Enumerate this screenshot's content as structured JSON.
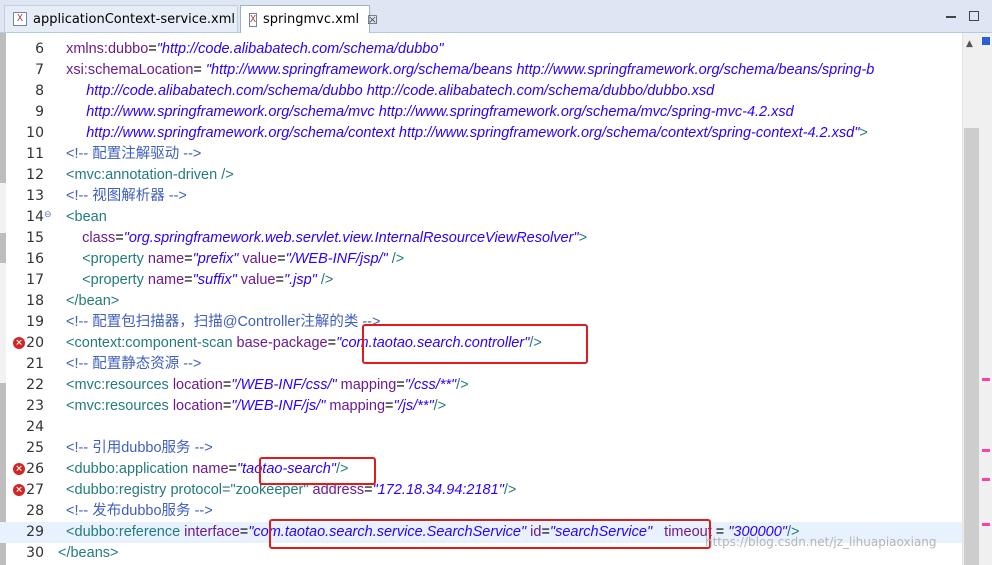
{
  "tabs": [
    {
      "label": "applicationContext-service.xml",
      "active": false
    },
    {
      "label": "springmvc.xml",
      "active": true,
      "close": "☒"
    }
  ],
  "lines": [
    {
      "n": "6",
      "tokens": [
        [
          "p",
          "  "
        ],
        [
          "a",
          "xmlns:dubbo"
        ],
        [
          "e",
          "="
        ],
        [
          "v",
          "\"http://code.alibabatech.com/schema/dubbo\""
        ]
      ]
    },
    {
      "n": "7",
      "tokens": [
        [
          "p",
          "  "
        ],
        [
          "a",
          "xsi:schemaLocation"
        ],
        [
          "e",
          "="
        ],
        [
          "v",
          " \"http://www.springframework.org/schema/beans http://www.springframework.org/schema/beans/spring-b"
        ]
      ]
    },
    {
      "n": "8",
      "tokens": [
        [
          "v",
          "       http://code.alibabatech.com/schema/dubbo http://code.alibabatech.com/schema/dubbo/dubbo.xsd"
        ]
      ]
    },
    {
      "n": "9",
      "tokens": [
        [
          "v",
          "       http://www.springframework.org/schema/mvc http://www.springframework.org/schema/mvc/spring-mvc-4.2.xsd"
        ]
      ]
    },
    {
      "n": "10",
      "tokens": [
        [
          "v",
          "       http://www.springframework.org/schema/context http://www.springframework.org/schema/context/spring-context-4.2.xsd\""
        ],
        [
          "t",
          ">"
        ]
      ]
    },
    {
      "n": "11",
      "tokens": [
        [
          "c",
          "  <!-- 配置注解驱动 -->"
        ]
      ]
    },
    {
      "n": "12",
      "tokens": [
        [
          "t",
          "  <mvc:annotation-driven />"
        ]
      ]
    },
    {
      "n": "13",
      "tokens": [
        [
          "c",
          "  <!-- 视图解析器 -->"
        ]
      ]
    },
    {
      "n": "14",
      "fold": true,
      "tokens": [
        [
          "t",
          "  <bean"
        ]
      ]
    },
    {
      "n": "15",
      "tokens": [
        [
          "a",
          "      class"
        ],
        [
          "e",
          "="
        ],
        [
          "v",
          "\"org.springframework.web.servlet.view.InternalResourceViewResolver\""
        ],
        [
          "t",
          ">"
        ]
      ]
    },
    {
      "n": "16",
      "tokens": [
        [
          "t",
          "      <property "
        ],
        [
          "a",
          "name"
        ],
        [
          "e",
          "="
        ],
        [
          "v",
          "\"prefix\""
        ],
        [
          "a",
          " value"
        ],
        [
          "e",
          "="
        ],
        [
          "v",
          "\"/WEB-INF/jsp/\""
        ],
        [
          "t",
          " />"
        ]
      ]
    },
    {
      "n": "17",
      "tokens": [
        [
          "t",
          "      <property "
        ],
        [
          "a",
          "name"
        ],
        [
          "e",
          "="
        ],
        [
          "v",
          "\"suffix\""
        ],
        [
          "a",
          " value"
        ],
        [
          "e",
          "="
        ],
        [
          "v",
          "\".jsp\""
        ],
        [
          "t",
          " />"
        ]
      ]
    },
    {
      "n": "18",
      "tokens": [
        [
          "t",
          "  </bean>"
        ]
      ]
    },
    {
      "n": "19",
      "tokens": [
        [
          "c",
          "  <!-- 配置包扫描器，扫描@Controller注解的类 -->"
        ]
      ]
    },
    {
      "n": "20",
      "error": true,
      "tokens": [
        [
          "t",
          "  <context:component-scan "
        ],
        [
          "a",
          "base-package"
        ],
        [
          "e",
          "="
        ],
        [
          "v",
          "\"com.taotao.search.controller\""
        ],
        [
          "t",
          "/>"
        ]
      ]
    },
    {
      "n": "21",
      "tokens": [
        [
          "c",
          "  <!-- 配置静态资源 -->"
        ]
      ]
    },
    {
      "n": "22",
      "tokens": [
        [
          "t",
          "  <mvc:resources "
        ],
        [
          "a",
          "location"
        ],
        [
          "e",
          "="
        ],
        [
          "v",
          "\"/WEB-INF/css/\""
        ],
        [
          "a",
          " mapping"
        ],
        [
          "e",
          "="
        ],
        [
          "v",
          "\"/css/**\""
        ],
        [
          "t",
          "/>"
        ]
      ]
    },
    {
      "n": "23",
      "tokens": [
        [
          "t",
          "  <mvc:resources "
        ],
        [
          "a",
          "location"
        ],
        [
          "e",
          "="
        ],
        [
          "v",
          "\"/WEB-INF/js/\""
        ],
        [
          "a",
          " mapping"
        ],
        [
          "e",
          "="
        ],
        [
          "v",
          "\"/js/**\""
        ],
        [
          "t",
          "/>"
        ]
      ]
    },
    {
      "n": "24",
      "tokens": [
        [
          "p",
          " "
        ]
      ]
    },
    {
      "n": "25",
      "tokens": [
        [
          "c",
          "  <!-- 引用dubbo服务 -->"
        ]
      ]
    },
    {
      "n": "26",
      "error": true,
      "tokens": [
        [
          "t",
          "  <dubbo:application "
        ],
        [
          "a",
          "name"
        ],
        [
          "e",
          "="
        ],
        [
          "v",
          "\"taotao-search\""
        ],
        [
          "t",
          "/>"
        ]
      ]
    },
    {
      "n": "27",
      "error": true,
      "tokens": [
        [
          "t",
          "  <dubbo:registry protocol=\"zookeeper\" "
        ],
        [
          "a",
          "address"
        ],
        [
          "e",
          "="
        ],
        [
          "v",
          "\"172.18.34.94:2181\""
        ],
        [
          "t",
          "/>"
        ]
      ]
    },
    {
      "n": "28",
      "tokens": [
        [
          "c",
          "  <!-- 发布dubbo服务 -->"
        ]
      ]
    },
    {
      "n": "29",
      "current": true,
      "tokens": [
        [
          "t",
          "  <dubbo:reference "
        ],
        [
          "a",
          "interface"
        ],
        [
          "e",
          "="
        ],
        [
          "v",
          "\"com.taotao.search.service.SearchService\""
        ],
        [
          "a",
          " id"
        ],
        [
          "e",
          "="
        ],
        [
          "v",
          "\"searchService\""
        ],
        [
          "a",
          "   timeout "
        ],
        [
          "e",
          "= "
        ],
        [
          "v",
          "\"300000\""
        ],
        [
          "t",
          "/>"
        ]
      ]
    },
    {
      "n": "30",
      "tokens": [
        [
          "t",
          "</beans>"
        ]
      ]
    }
  ],
  "watermark": "https://blog.csdn.net/jz_lihuapiaoxiang",
  "colors": {
    "tag": "#237b7b",
    "attr": "#6e1a8e",
    "value": "#2a00ff",
    "comment": "#3f5fbf",
    "highlight": "#e01b1b"
  }
}
